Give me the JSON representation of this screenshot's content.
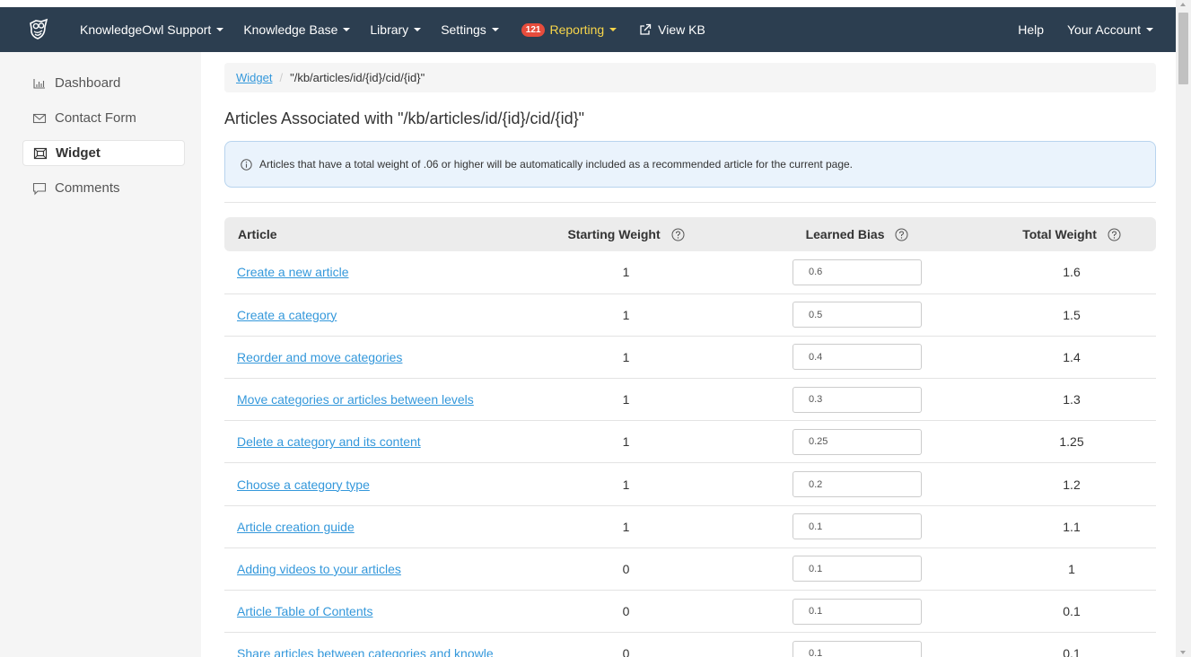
{
  "topnav": {
    "brand": "KnowledgeOwl Support",
    "items": [
      {
        "label": "Knowledge Base"
      },
      {
        "label": "Library"
      },
      {
        "label": "Settings"
      }
    ],
    "reporting": {
      "badge": "121",
      "label": "Reporting"
    },
    "view_kb": "View KB",
    "help": "Help",
    "account": "Your Account",
    "colors": {
      "bar": "#2c3e50",
      "reporting": "#f7d54a",
      "badge": "#e74c3c"
    }
  },
  "sidebar": {
    "items": [
      {
        "label": "Dashboard",
        "icon": "bar-chart-icon"
      },
      {
        "label": "Contact Form",
        "icon": "envelope-icon"
      },
      {
        "label": "Widget",
        "icon": "widget-icon",
        "active": true
      },
      {
        "label": "Comments",
        "icon": "comment-icon"
      }
    ]
  },
  "breadcrumb": {
    "link": "Widget",
    "separator": "/",
    "current": "\"/kb/articles/id/{id}/cid/{id}\""
  },
  "page_title": "Articles Associated with \"/kb/articles/id/{id}/cid/{id}\"",
  "info": "Articles that have a total weight of .06 or higher will be automatically included as a recommended article for the current page.",
  "table": {
    "headers": {
      "article": "Article",
      "starting_weight": "Starting Weight",
      "learned_bias": "Learned Bias",
      "total_weight": "Total Weight"
    },
    "rows": [
      {
        "title": "Create a new article",
        "starting": "1",
        "bias": "0.6",
        "total": "1.6"
      },
      {
        "title": "Create a category",
        "starting": "1",
        "bias": "0.5",
        "total": "1.5"
      },
      {
        "title": "Reorder and move categories",
        "starting": "1",
        "bias": "0.4",
        "total": "1.4"
      },
      {
        "title": "Move categories or articles between levels",
        "starting": "1",
        "bias": "0.3",
        "total": "1.3"
      },
      {
        "title": "Delete a category and its content",
        "starting": "1",
        "bias": "0.25",
        "total": "1.25"
      },
      {
        "title": "Choose a category type",
        "starting": "1",
        "bias": "0.2",
        "total": "1.2"
      },
      {
        "title": "Article creation guide",
        "starting": "1",
        "bias": "0.1",
        "total": "1.1"
      },
      {
        "title": "Adding videos to your articles",
        "starting": "0",
        "bias": "0.1",
        "total": "1"
      },
      {
        "title": "Article Table of Contents",
        "starting": "0",
        "bias": "0.1",
        "total": "0.1"
      },
      {
        "title": "Share articles between categories and knowle",
        "starting": "0",
        "bias": "0.1",
        "total": "0.1"
      }
    ]
  }
}
